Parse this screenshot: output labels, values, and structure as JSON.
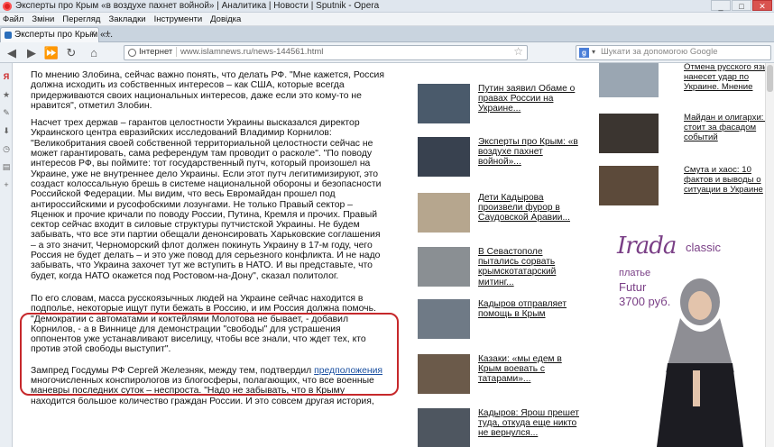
{
  "window": {
    "title": "Эксперты про Крым «в воздухе пахнет войной» | Аналитика | Новости | Sputnik - Opera"
  },
  "menu": [
    "Файл",
    "Змiни",
    "Перегляд",
    "Закладки",
    "Iнструменти",
    "Довiдка"
  ],
  "tab": {
    "label": "Эксперты про Крым «..."
  },
  "toolbar": {
    "badge": "Інтернет",
    "url": "www.islamnews.ru/news-144561.html",
    "search_placeholder": "Шукати за допомогою Google"
  },
  "article": {
    "p1": "По мнению Злобина, сейчас важно понять, что делать РФ. \"Мне кажется, Россия должна исходить из собственных интересов – как США, которые всегда придерживаются своих национальных интересов, даже если это кому-то не нравится\", отметил Злобин.",
    "p2": "Насчет трех держав – гарантов целостности Украины высказался директор Украинского центра евразийских исследований Владимир Корнилов: \"Великобритания своей собственной территориальной целостности сейчас не может гарантировать, сама референдум там проводит о расколе\". \"По поводу интересов РФ, вы поймите: тот государственный путч, который произошел на Украине, уже не внутреннее дело Украины. Если этот путч легитимизируют, это создаст колоссальную брешь в системе национальной обороны и безопасности Российской Федерации. Мы видим, что весь Евромайдан прошел под антироссийскими и русофобскими лозунгами. Не только Правый сектор – Яценюк и прочие кричали по поводу России, Путина, Кремля и прочих. Правый сектор сейчас входит в силовые структуры путчистской Украины. Не будем забывать, что все эти партии обещали денонсировать Харьковские соглашения – а это значит, Черноморский флот должен покинуть Украину в 17-м году, чего Россия не будет делать – и это уже повод для серьезного конфликта. И не надо забывать, что Украина захочет тут же вступить в НАТО. И вы представьте, что будет, когда НАТО окажется под Ростовом-на-Дону\", сказал политолог.",
    "p3": "По его словам, масса русскоязычных людей на Украине сейчас находится в подполье, некоторые ищут пути бежать в Россию, и им Россия должна помочь. \"Демократии с автоматами и коктейлями Молотова не бывает, - добавил Корнилов, - а в Виннице для демонстрации \"свободы\" для устрашения оппонентов уже устанавливают виселицу, чтобы все знали, что ждет тех, кто против этой свободы выступит\".",
    "p4_pre": "Зампред Госдумы РФ Сергей Железняк, между тем, подтвердил ",
    "p4_link": "предположения",
    "p4_post": " многочисленных конспирологов из блогосферы, полагающих, что все военные маневры последних суток – неспроста. \"Надо не забывать, что в Крыму находится большое количество граждан России. И это совсем другая история,"
  },
  "news": [
    {
      "title": "Путин заявил Обаме о правах России на Украине...",
      "color": "#4a5a6b"
    },
    {
      "title": "Эксперты про Крым: «в воздухе пахнет войной»...",
      "color": "#38414f"
    },
    {
      "title": "Дети Кадырова произвели фурор в Саудовской Аравии...",
      "color": "#b6a68e"
    },
    {
      "title": "В Севастополе пытались сорвать крымскотатарский митинг...",
      "color": "#8a8f93"
    },
    {
      "title": "Кадыров отправляет помощь в Крым",
      "color": "#6f7a86"
    },
    {
      "title": "Казаки: «мы едем в Крым воевать с татарами»...",
      "color": "#6b5a4a"
    },
    {
      "title": "Кадыров: Ярош прешет туда, откуда еще никто не вернулся...",
      "color": "#4e5660"
    }
  ],
  "right_news": [
    {
      "title": "Отмена русского языка нанесет удар по Украине. Мнение",
      "color": "#9aa6b2"
    },
    {
      "title": "Майдан и олигархи: что стоит за фасадом событий",
      "color": "#3b3530"
    },
    {
      "title": "Смута и хаос: 10 фактов и выводы о ситуации в Украине",
      "color": "#5c4a3a"
    }
  ],
  "ad": {
    "brand": "Irada",
    "brand_sub": "classic",
    "line1": "платье",
    "line2": "Futur",
    "line3": "3700 руб."
  }
}
